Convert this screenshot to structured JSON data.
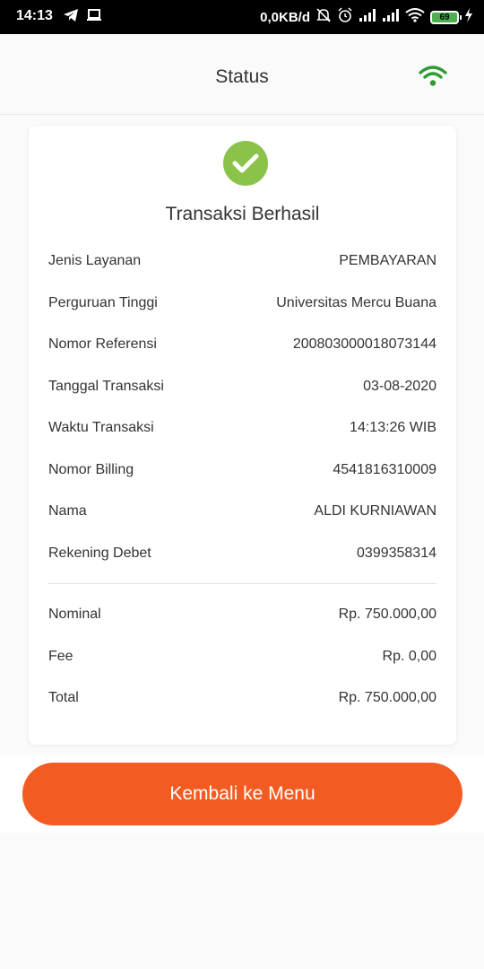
{
  "status_bar": {
    "time": "14:13",
    "net_speed": "0,0KB/d",
    "battery": "69"
  },
  "header": {
    "title": "Status",
    "connection_icon": "wifi-icon",
    "connection_color": "#2e9b33"
  },
  "result": {
    "icon": "check-circle-icon",
    "icon_color": "#8bc34a",
    "title": "Transaksi Berhasil"
  },
  "details": [
    {
      "label": "Jenis Layanan",
      "value": "PEMBAYARAN"
    },
    {
      "label": "Perguruan Tinggi",
      "value": "Universitas Mercu Buana"
    },
    {
      "label": "Nomor Referensi",
      "value": "200803000018073144"
    },
    {
      "label": "Tanggal Transaksi",
      "value": "03-08-2020"
    },
    {
      "label": "Waktu Transaksi",
      "value": "14:13:26 WIB"
    },
    {
      "label": "Nomor Billing",
      "value": "4541816310009"
    },
    {
      "label": "Nama",
      "value": "ALDI KURNIAWAN"
    },
    {
      "label": "Rekening Debet",
      "value": "0399358314"
    }
  ],
  "amounts": [
    {
      "label": "Nominal",
      "value": "Rp. 750.000,00"
    },
    {
      "label": "Fee",
      "value": "Rp. 0,00"
    },
    {
      "label": "Total",
      "value": "Rp. 750.000,00"
    }
  ],
  "footer": {
    "button_label": "Kembali ke Menu",
    "button_color": "#f25c22"
  }
}
